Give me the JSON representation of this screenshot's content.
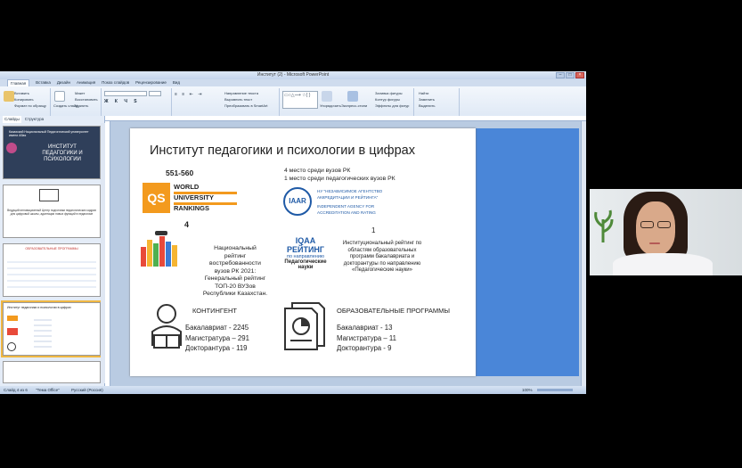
{
  "window": {
    "title": "Институт (2) - Microsoft PowerPoint",
    "tabs": [
      "Главная",
      "Вставка",
      "Дизайн",
      "Анимация",
      "Показ слайдов",
      "Рецензирование",
      "Вид"
    ],
    "ribbon": {
      "paste": "Вставить",
      "cut": "Вырезать",
      "copy": "Копировать",
      "format_painter": "Формат по образцу",
      "clipboard_group": "Буфер обмена",
      "new_slide": "Создать слайд",
      "layout": "Макет",
      "reset": "Восстановить",
      "delete": "Удалить",
      "slides_group": "Слайды",
      "font_group": "Шрифт",
      "paragraph_group": "Абзац",
      "text_direction": "Направление текста",
      "align_text": "Выровнять текст",
      "smartart": "Преобразовать в SmartArt",
      "drawing_group": "Рисование",
      "arrange": "Упорядочить",
      "quick_styles": "Экспресс-стили",
      "fill": "Заливка фигуры",
      "outline": "Контур фигуры",
      "effects": "Эффекты для фигур",
      "find": "Найти",
      "replace": "Заменить",
      "select": "Выделить",
      "editing_group": "Редактирование"
    },
    "panel_tabs": [
      "Слайды",
      "Структура"
    ],
    "status": {
      "slide": "Слайд 4 из 6",
      "theme": "\"Тема Office\"",
      "language": "Русский (Россия)",
      "zoom": "100%"
    }
  },
  "thumbnails": [
    {
      "title": "ИНСТИТУТ ПЕДАГОГИКИ И ПСИХОЛОГИИ",
      "header": "Казахский Национальный Педагогический университет имени Абая",
      "kind": "dark"
    },
    {
      "title": "Ведущий инновационный Центр подготовки педагогических кадров для цифровой школы, адаптации новых функций в педагогике",
      "kind": "white"
    },
    {
      "title": "ОБРАЗОВАТЕЛЬНЫЕ ПРОГРАММЫ",
      "kind": "list"
    },
    {
      "title": "Институт педагогики и психологии в цифрах",
      "kind": "selected"
    },
    {
      "title": "",
      "kind": "partial"
    }
  ],
  "slide": {
    "title": "Институт педагогики и психологии в цифрах",
    "qs": {
      "rank": "551-560",
      "logo": "QS",
      "line1": "WORLD",
      "line2": "UNIVERSITY",
      "line3": "RANKINGS"
    },
    "iaar": {
      "line1": "4 место среди вузов РК",
      "line2": "1 место среди педагогических вузов РК",
      "logo": "IAAR",
      "org1": "НУ \"НЕЗАВИСИМОЕ АГЕНТСТВО",
      "org2": "АККРЕДИТАЦИИ И РЕЙТИНГА\"",
      "org3": "INDEPENDENT AGENCY FOR",
      "org4": "ACCREDITATION AND RATING"
    },
    "national": {
      "number": "4",
      "lines": [
        "Национальный",
        "рейтинг",
        "востребованности",
        "вузов РК 2021:",
        "Генеральный рейтинг",
        "ТОП-20 ВУЗов",
        "Республики Казахстан."
      ]
    },
    "iqaa": {
      "number": "1",
      "logo": "IQAA",
      "l1": "РЕЙТИНГ",
      "l2": "по направлению",
      "l3": "Педагогические",
      "l4": "науки",
      "lines": [
        "Институциональный рейтинг по",
        "областям образовательных",
        "программ бакалавриата и",
        "докторантуры по направлению",
        "«Педагогические науки»"
      ]
    },
    "contingent": {
      "title": "КОНТИНГЕНТ",
      "items": [
        "Бакалавриат - 2245",
        "Магистратура – 291",
        "Докторантура - 119"
      ]
    },
    "programs": {
      "title": "ОБРАЗОВАТЕЛЬНЫЕ ПРОГРАММЫ",
      "items": [
        "Бакалавриат - 13",
        "Магистратура – 11",
        "Докторантура - 9"
      ]
    }
  },
  "colors": {
    "accent": "#4a86d8",
    "qs_orange": "#f39a1e",
    "iaar_blue": "#1f5aa6"
  }
}
